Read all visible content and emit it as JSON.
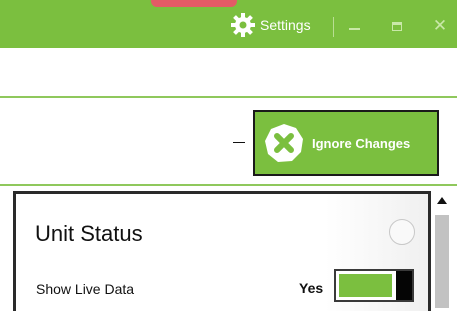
{
  "titlebar": {
    "settings_label": "Settings",
    "minimize_icon": "minimize-icon",
    "maximize_icon": "maximize-icon",
    "close_icon": "close-icon",
    "close_glyph": "✕"
  },
  "actions": {
    "ignore_label": "Ignore Changes",
    "ignore_icon": "x-circle-icon"
  },
  "panel": {
    "title": "Unit Status",
    "rows": [
      {
        "label": "Show Live Data",
        "value": "Yes",
        "on": true
      }
    ]
  },
  "colors": {
    "accent_green": "#7bbf3f",
    "accent_red": "#e35b66",
    "border_dark": "#2a2a2a"
  }
}
